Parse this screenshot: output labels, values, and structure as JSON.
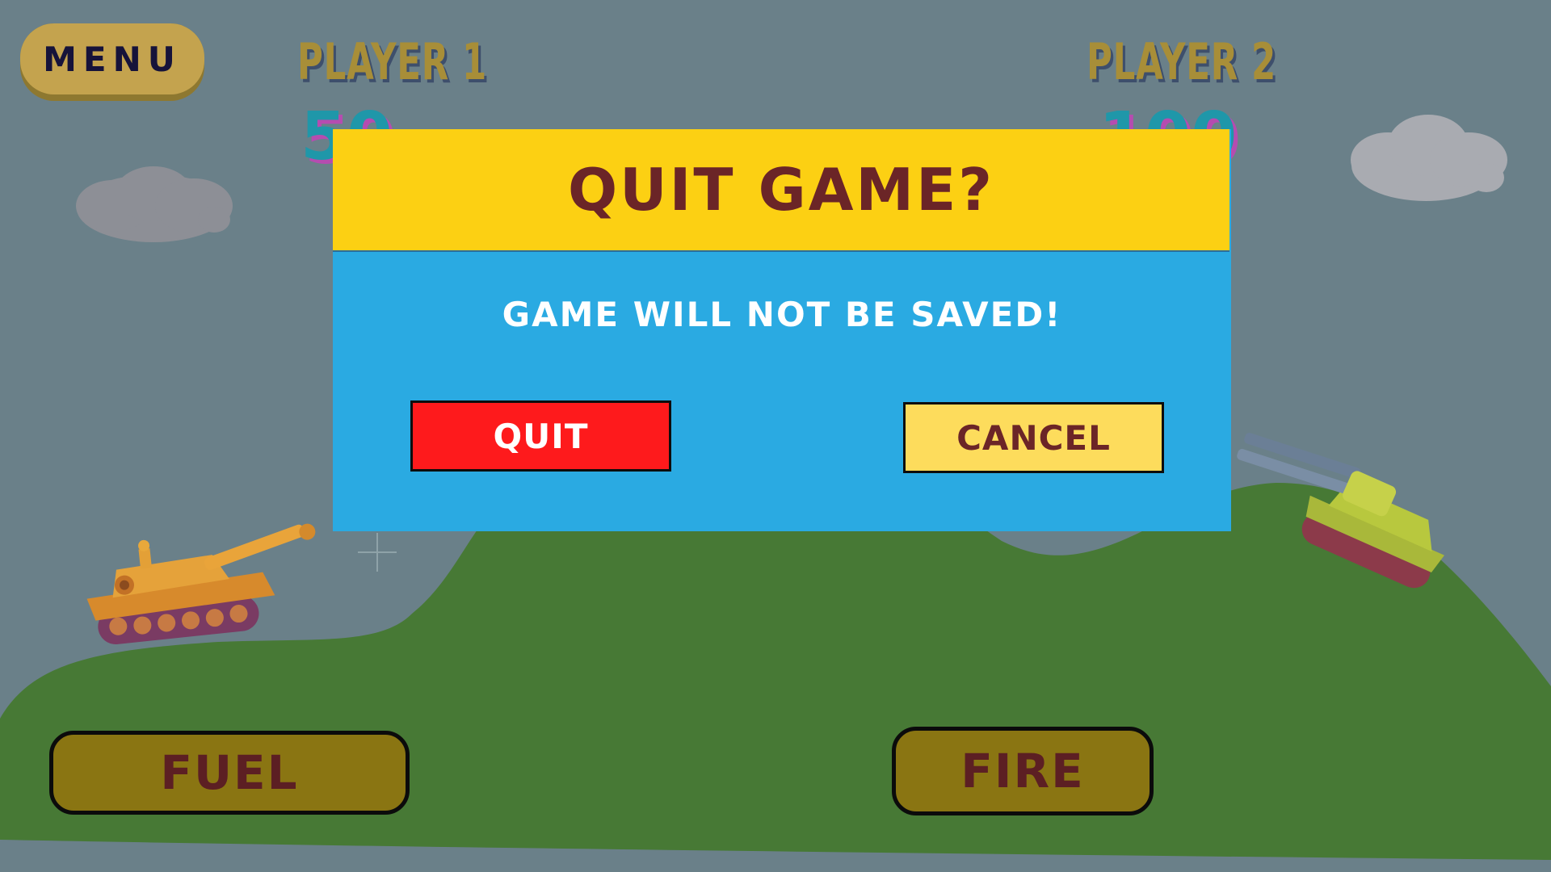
{
  "hud": {
    "menu_label": "MENU",
    "player1": {
      "label": "PLAYER 1",
      "score": "50"
    },
    "player2": {
      "label": "PLAYER 2",
      "score": "100"
    }
  },
  "controls": {
    "fuel_label": "FUEL",
    "fire_label": "FIRE"
  },
  "dialog": {
    "title": "QUIT GAME?",
    "message": "GAME WILL NOT BE SAVED!",
    "quit_label": "QUIT",
    "cancel_label": "CANCEL"
  },
  "colors": {
    "sky": "#6a8089",
    "hill": "#477935",
    "dialog_body": "#2aaae2",
    "dialog_header": "#fcd013",
    "quit_button": "#fe1a1c",
    "cancel_button": "#fddc5c",
    "action_button": "#8a7512",
    "menu_button": "#c4a34e"
  },
  "icons": {
    "player1_tank": "orange-tank-icon",
    "player2_tank": "green-twin-cannon-tank-icon",
    "crosshair": "crosshair-icon",
    "clouds": "cloud-icon"
  }
}
